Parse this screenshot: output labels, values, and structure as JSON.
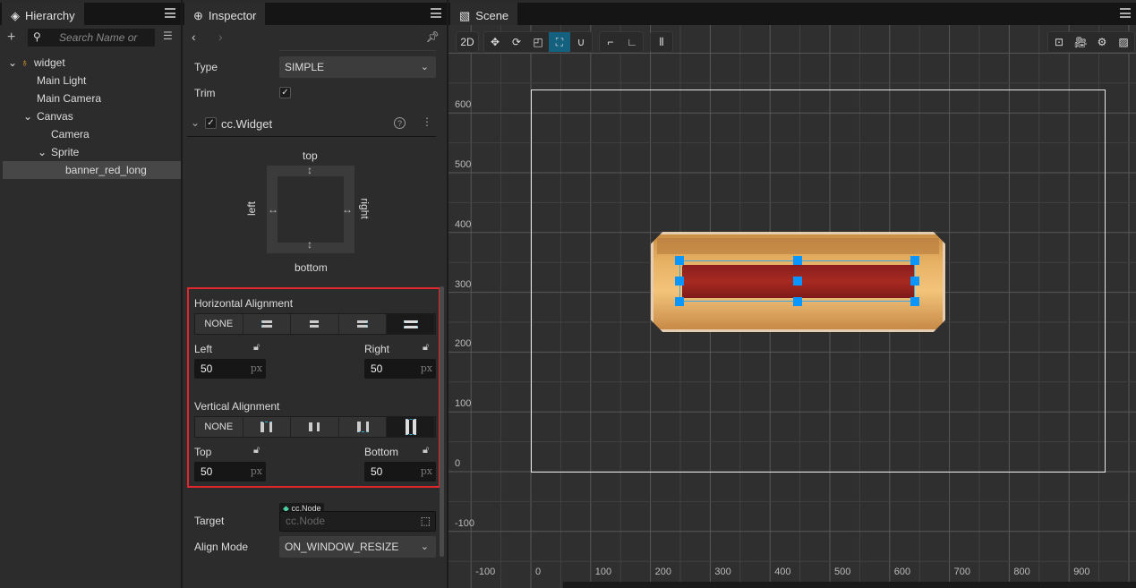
{
  "hierarchy": {
    "title": "Hierarchy",
    "search_placeholder": "Search Name or",
    "items": [
      {
        "label": "widget"
      },
      {
        "label": "Main Light"
      },
      {
        "label": "Main Camera"
      },
      {
        "label": "Canvas"
      },
      {
        "label": "Camera"
      },
      {
        "label": "Sprite"
      },
      {
        "label": "banner_red_long"
      }
    ]
  },
  "inspector": {
    "title": "Inspector",
    "type_label": "Type",
    "type_value": "SIMPLE",
    "trim_label": "Trim",
    "trim_checked": true,
    "component": "cc.Widget",
    "widget_diagram": {
      "top": "top",
      "bottom": "bottom",
      "left": "left",
      "right": "right"
    },
    "h_align": {
      "label": "Horizontal Alignment",
      "none": "NONE",
      "selected": "stretch",
      "left_label": "Left",
      "left_value": "50",
      "right_label": "Right",
      "right_value": "50",
      "unit": "px"
    },
    "v_align": {
      "label": "Vertical Alignment",
      "none": "NONE",
      "selected": "stretch",
      "top_label": "Top",
      "top_value": "50",
      "bottom_label": "Bottom",
      "bottom_value": "50",
      "unit": "px"
    },
    "target_label": "Target",
    "target_tag": "cc.Node",
    "target_placeholder": "cc.Node",
    "align_mode_label": "Align Mode",
    "align_mode_value": "ON_WINDOW_RESIZE"
  },
  "scene": {
    "title": "Scene",
    "mode_2d": "2D",
    "x_ticks": [
      "-100",
      "0",
      "100",
      "200",
      "300",
      "400",
      "500",
      "600",
      "700",
      "800",
      "900"
    ],
    "y_ticks": [
      "600",
      "500",
      "400",
      "300",
      "200",
      "100",
      "0",
      "-100"
    ],
    "active_tool": "rect"
  },
  "colors": {
    "highlight": "#e0262e",
    "accent": "#14607f",
    "handle": "#0a96ff"
  }
}
